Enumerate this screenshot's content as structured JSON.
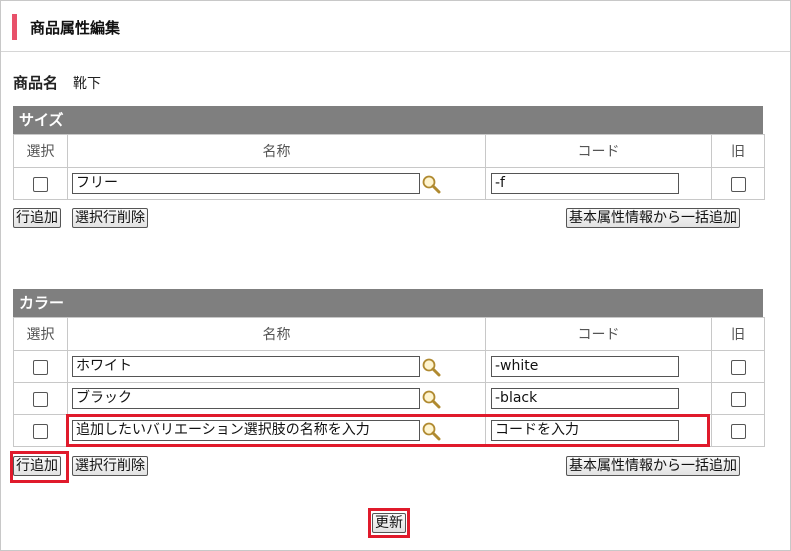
{
  "header": {
    "title": "商品属性編集"
  },
  "product": {
    "label": "商品名",
    "value": "靴下"
  },
  "columns": {
    "select": "選択",
    "name": "名称",
    "code": "コード",
    "old": "旧"
  },
  "size": {
    "title": "サイズ",
    "rows": [
      {
        "name": "フリー",
        "code": "-f"
      }
    ],
    "add_row": "行追加",
    "delete_selected": "選択行削除",
    "bulk_add": "基本属性情報から一括追加"
  },
  "color": {
    "title": "カラー",
    "rows": [
      {
        "name": "ホワイト",
        "code": "-white"
      },
      {
        "name": "ブラック",
        "code": "-black"
      },
      {
        "name": "追加したいバリエーション選択肢の名称を入力",
        "code": "コードを入力"
      }
    ],
    "add_row": "行追加",
    "delete_selected": "選択行削除",
    "bulk_add": "基本属性情報から一括追加"
  },
  "update_button": "更新",
  "colors": {
    "accent": "#e8516a",
    "section_header": "#7f7f7f",
    "highlight": "#e01a2b"
  },
  "icons": {
    "search": "magnifier-icon"
  }
}
